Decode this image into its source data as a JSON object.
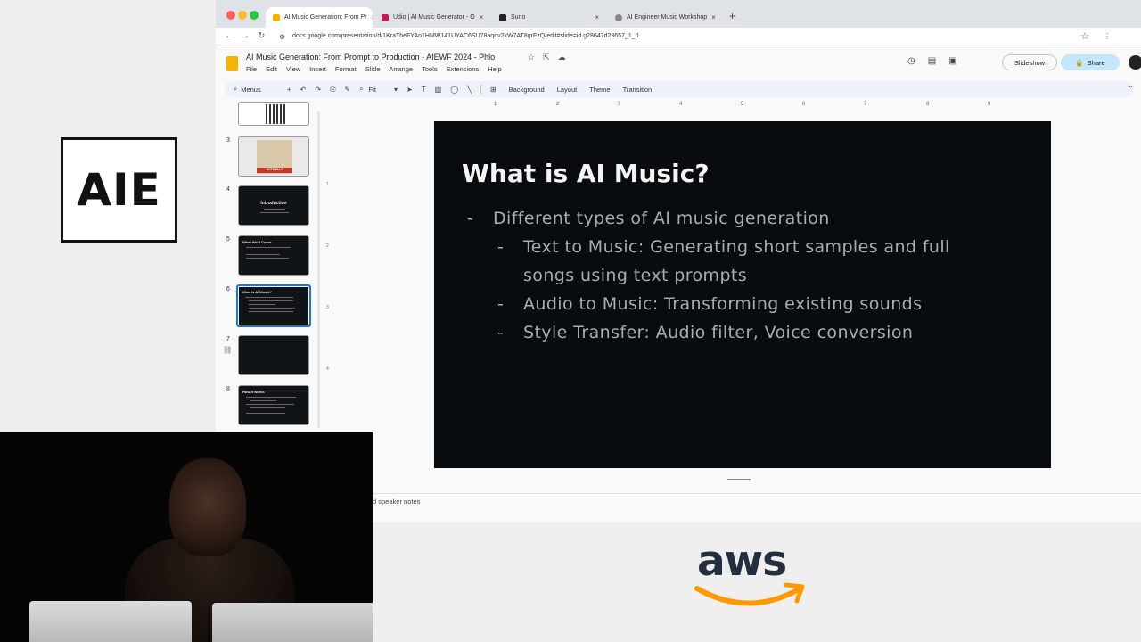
{
  "event_logo": {
    "text": "AIE"
  },
  "sponsor_logo": {
    "text": "aws",
    "color": "#232f3e",
    "smile_color": "#ff9900"
  },
  "browser": {
    "tabs": [
      {
        "label": "AI Music Generation: From Pr",
        "icon": "slides-icon",
        "active": true
      },
      {
        "label": "Udio | AI Music Generator - O",
        "icon": "udio-icon",
        "active": false
      },
      {
        "label": "Suno",
        "icon": "suno-icon",
        "active": false
      },
      {
        "label": "AI Engineer Music Workshop",
        "icon": "globe-icon",
        "active": false
      }
    ],
    "url": "docs.google.com/presentation/d/1KraTbeFYAn1HMW141UYAC6SU78aqqv2kW7AT8grFzQ/edit#slide=id.g28647d28657_1_0"
  },
  "slides_app": {
    "doc_title": "AI Music Generation: From Prompt to Production - AIEWF 2024 - Phlo",
    "menu": [
      "File",
      "Edit",
      "View",
      "Insert",
      "Format",
      "Slide",
      "Arrange",
      "Tools",
      "Extensions",
      "Help"
    ],
    "slideshow_label": "Slideshow",
    "share_label": "Share",
    "toolbar": {
      "search_label": "Menus",
      "zoom_label": "Fit",
      "background_label": "Background",
      "layout_label": "Layout",
      "theme_label": "Theme",
      "transition_label": "Transition"
    },
    "ruler_numbers": [
      "1",
      "2",
      "3",
      "4",
      "5",
      "6",
      "7",
      "8",
      "9"
    ],
    "ruler_left_numbers": [
      "1",
      "2",
      "3",
      "4"
    ],
    "filmstrip": [
      {
        "number": "",
        "kind": "qr"
      },
      {
        "number": "3",
        "kind": "meme",
        "caption": "ACTUALLY"
      },
      {
        "number": "4",
        "kind": "title",
        "title": "Introduction"
      },
      {
        "number": "5",
        "kind": "bullets",
        "title": "What We'll Cover"
      },
      {
        "number": "6",
        "kind": "bullets",
        "title": "What is AI Music?",
        "selected": true
      },
      {
        "number": "7",
        "kind": "blank"
      },
      {
        "number": "8",
        "kind": "bullets",
        "title": "How it works"
      }
    ],
    "speaker_notes_label": "d speaker notes"
  },
  "slide": {
    "title": "What is AI Music?",
    "bullets": [
      {
        "level": 1,
        "lines": [
          "Different types of AI music generation"
        ]
      },
      {
        "level": 2,
        "lines": [
          "Text to Music: Generating short samples and full",
          "songs using text prompts"
        ]
      },
      {
        "level": 2,
        "lines": [
          "Audio to Music: Transforming existing sounds"
        ]
      },
      {
        "level": 2,
        "lines": [
          "Style Transfer: Audio filter, Voice conversion"
        ]
      }
    ],
    "dash": "-",
    "background": "#080c0e",
    "title_color": "#f4f4f4",
    "text_color": "#a9adb0"
  }
}
